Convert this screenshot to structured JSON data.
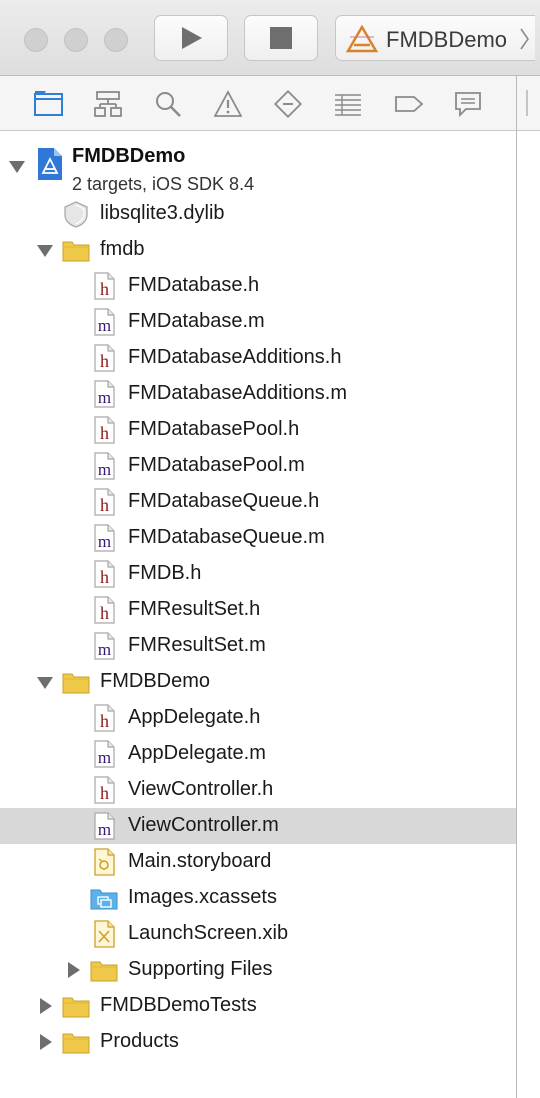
{
  "toolbar": {
    "scheme_name": "FMDBDemo"
  },
  "navigator": {
    "tabs": [
      {
        "name": "project-navigator-icon"
      },
      {
        "name": "symbol-navigator-icon"
      },
      {
        "name": "find-navigator-icon"
      },
      {
        "name": "issue-navigator-icon"
      },
      {
        "name": "test-navigator-icon"
      },
      {
        "name": "debug-navigator-icon"
      },
      {
        "name": "breakpoint-navigator-icon"
      },
      {
        "name": "report-navigator-icon"
      }
    ]
  },
  "project": {
    "name": "FMDBDemo",
    "subtitle": "2 targets, iOS SDK 8.4"
  },
  "tree": [
    {
      "label": "libsqlite3.dylib",
      "kind": "dylib",
      "depth": 1,
      "disclosure": "none"
    },
    {
      "label": "fmdb",
      "kind": "folder",
      "depth": 1,
      "disclosure": "open"
    },
    {
      "label": "FMDatabase.h",
      "kind": "h",
      "depth": 2,
      "disclosure": "none"
    },
    {
      "label": "FMDatabase.m",
      "kind": "m",
      "depth": 2,
      "disclosure": "none"
    },
    {
      "label": "FMDatabaseAdditions.h",
      "kind": "h",
      "depth": 2,
      "disclosure": "none"
    },
    {
      "label": "FMDatabaseAdditions.m",
      "kind": "m",
      "depth": 2,
      "disclosure": "none"
    },
    {
      "label": "FMDatabasePool.h",
      "kind": "h",
      "depth": 2,
      "disclosure": "none"
    },
    {
      "label": "FMDatabasePool.m",
      "kind": "m",
      "depth": 2,
      "disclosure": "none"
    },
    {
      "label": "FMDatabaseQueue.h",
      "kind": "h",
      "depth": 2,
      "disclosure": "none"
    },
    {
      "label": "FMDatabaseQueue.m",
      "kind": "m",
      "depth": 2,
      "disclosure": "none"
    },
    {
      "label": "FMDB.h",
      "kind": "h",
      "depth": 2,
      "disclosure": "none"
    },
    {
      "label": "FMResultSet.h",
      "kind": "h",
      "depth": 2,
      "disclosure": "none"
    },
    {
      "label": "FMResultSet.m",
      "kind": "m",
      "depth": 2,
      "disclosure": "none"
    },
    {
      "label": "FMDBDemo",
      "kind": "folder",
      "depth": 1,
      "disclosure": "open"
    },
    {
      "label": "AppDelegate.h",
      "kind": "h",
      "depth": 2,
      "disclosure": "none"
    },
    {
      "label": "AppDelegate.m",
      "kind": "m",
      "depth": 2,
      "disclosure": "none"
    },
    {
      "label": "ViewController.h",
      "kind": "h",
      "depth": 2,
      "disclosure": "none"
    },
    {
      "label": "ViewController.m",
      "kind": "m",
      "depth": 2,
      "disclosure": "none",
      "selected": true
    },
    {
      "label": "Main.storyboard",
      "kind": "storyboard",
      "depth": 2,
      "disclosure": "none"
    },
    {
      "label": "Images.xcassets",
      "kind": "xcassets",
      "depth": 2,
      "disclosure": "none"
    },
    {
      "label": "LaunchScreen.xib",
      "kind": "xib",
      "depth": 2,
      "disclosure": "none"
    },
    {
      "label": "Supporting Files",
      "kind": "folder",
      "depth": 2,
      "disclosure": "closed"
    },
    {
      "label": "FMDBDemoTests",
      "kind": "folder",
      "depth": 1,
      "disclosure": "closed"
    },
    {
      "label": "Products",
      "kind": "folder",
      "depth": 1,
      "disclosure": "closed"
    }
  ],
  "colors": {
    "header_letter": "#8b1a1a",
    "impl_letter": "#3a1a6e",
    "folder": "#f0c94a",
    "selection": "#d8d8d8"
  }
}
